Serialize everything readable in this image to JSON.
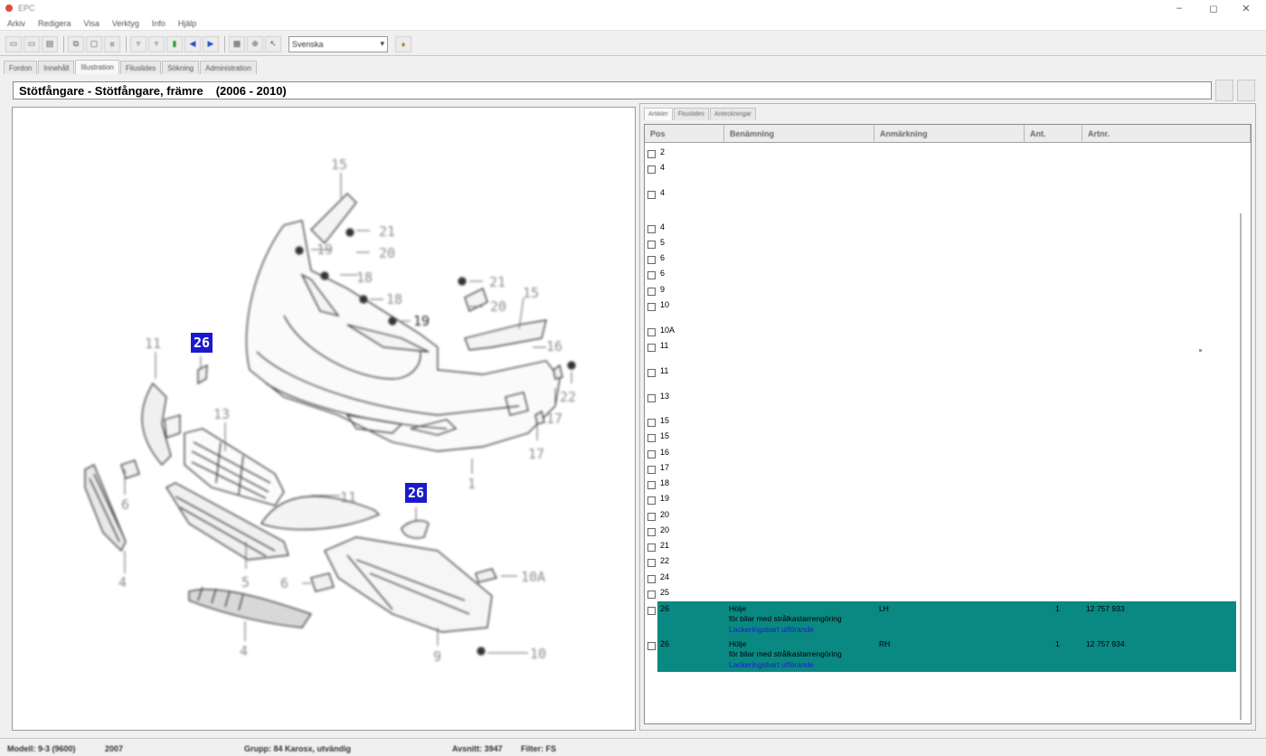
{
  "window": {
    "title": "EPC"
  },
  "menu": [
    "Arkiv",
    "Redigera",
    "Visa",
    "Verktyg",
    "Info",
    "Hjälp"
  ],
  "toolbar": {
    "language_value": "Svenska"
  },
  "main_tabs": [
    "Fordon",
    "Innehåll",
    "Illustration",
    "Fliuslides",
    "Sökning",
    "Administration"
  ],
  "page_title": {
    "part": "Stötfångare - Stötfångare, främre",
    "years": "(2006 - 2010)"
  },
  "diagram": {
    "callouts": [
      "15",
      "21",
      "19",
      "20",
      "18",
      "18",
      "19",
      "21",
      "15",
      "20",
      "16",
      "11",
      "22",
      "17",
      "17",
      "13",
      "1",
      "11",
      "6",
      "5",
      "6",
      "10A",
      "4",
      "4",
      "9",
      "10"
    ],
    "badges": [
      "26",
      "26"
    ]
  },
  "right_tabs": [
    "Artikler",
    "Fliuslides",
    "Anteckningar"
  ],
  "grid": {
    "headers": [
      "Pos",
      "Benämning",
      "Anmärkning",
      "Ant.",
      "Artnr."
    ],
    "rows": [
      "2",
      "4",
      "4",
      "4",
      "5",
      "6",
      "6",
      "9",
      "10",
      "10A",
      "11",
      "11",
      "13",
      "15",
      "15",
      "16",
      "17",
      "18",
      "19",
      "20",
      "20",
      "21",
      "22",
      "24",
      "25"
    ],
    "highlighted": [
      {
        "pos": "26",
        "name": "Hölje",
        "desc": "för bilar med strålkastarrengöring",
        "note": "Lackeringsbart utförande",
        "remark": "LH",
        "qty": "1",
        "partno": "12 757 933"
      },
      {
        "pos": "26",
        "name": "Hölje",
        "desc": "för bilar med strålkastarrengöring",
        "note": "Lackeringsbart utförande",
        "remark": "RH",
        "qty": "1",
        "partno": "12 757 934"
      }
    ]
  },
  "statusbar": {
    "model": "Modell: 9-3 (9600)",
    "year": "2007",
    "group": "Grupp: 84 Karosx, utvändig",
    "count": "Avsnitt: 3947",
    "filter": "Filter: FS"
  },
  "colors": {
    "highlight": "#0a8882",
    "badge": "#1a1acc",
    "link": "#1a20c8"
  }
}
